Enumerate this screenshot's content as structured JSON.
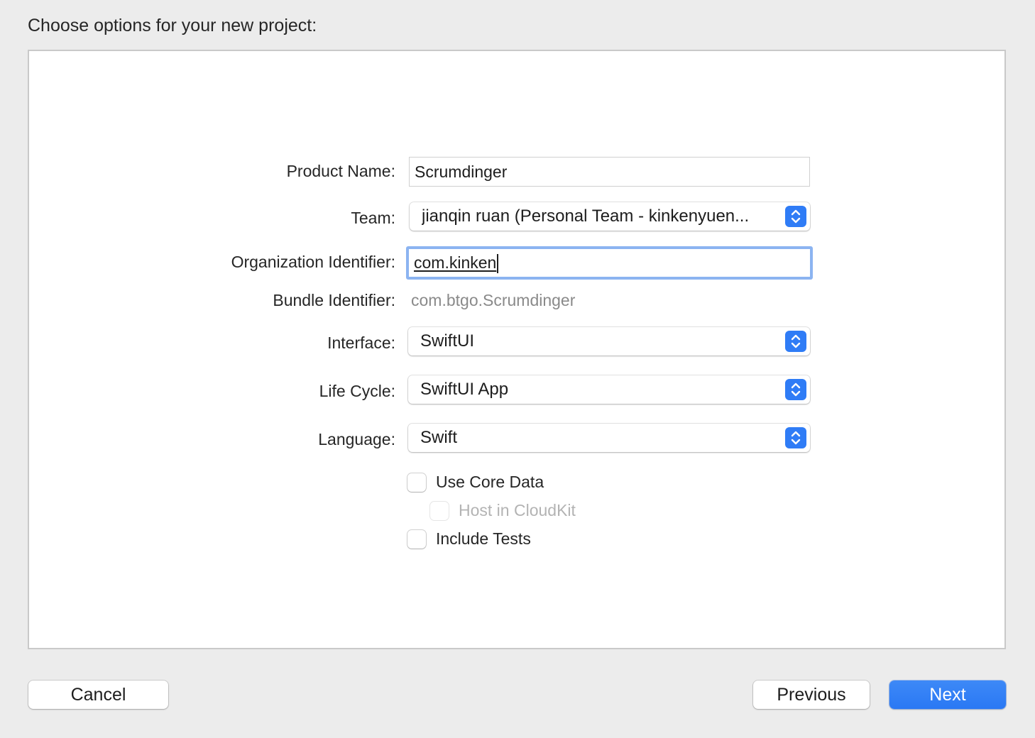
{
  "dialog": {
    "heading": "Choose options for your new project:"
  },
  "form": {
    "product_name": {
      "label": "Product Name:",
      "value": "Scrumdinger"
    },
    "team": {
      "label": "Team:",
      "value": "jianqin ruan (Personal Team - kinkenyuen..."
    },
    "organization_identifier": {
      "label": "Organization Identifier:",
      "value": "com.kinken"
    },
    "bundle_identifier": {
      "label": "Bundle Identifier:",
      "value": "com.btgo.Scrumdinger"
    },
    "interface": {
      "label": "Interface:",
      "value": "SwiftUI"
    },
    "life_cycle": {
      "label": "Life Cycle:",
      "value": "SwiftUI App"
    },
    "language": {
      "label": "Language:",
      "value": "Swift"
    },
    "use_core_data": {
      "label": "Use Core Data",
      "checked": false
    },
    "host_in_cloudkit": {
      "label": "Host in CloudKit",
      "checked": false,
      "enabled": false
    },
    "include_tests": {
      "label": "Include Tests",
      "checked": false
    }
  },
  "buttons": {
    "cancel": "Cancel",
    "previous": "Previous",
    "next": "Next"
  },
  "colors": {
    "accent": "#2f7cf6",
    "focus_ring": "#8cb4f1",
    "disabled_text": "#b3b3b3",
    "secondary_text": "#8a8a8a"
  }
}
